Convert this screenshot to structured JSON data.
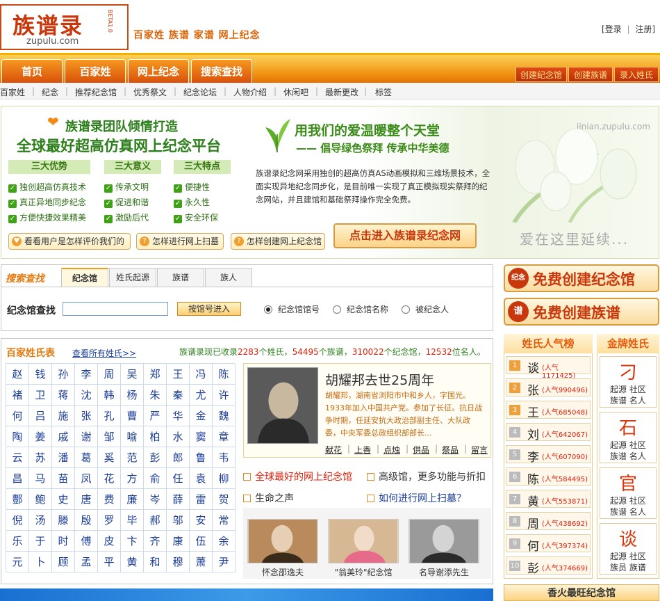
{
  "header": {
    "logo_text": "族谱录",
    "logo_domain": "zupulu.com",
    "logo_side": "BETA1.0",
    "slogan": "百家姓  族谱  家谱  网上纪念",
    "login": "[登录",
    "register": "注册]"
  },
  "nav": {
    "tabs": [
      "首页",
      "百家姓",
      "网上纪念",
      "搜索查找"
    ],
    "actions": [
      "创建纪念馆",
      "创建族谱",
      "录入姓氏"
    ],
    "sub": [
      "百家姓",
      "纪念",
      "推荐纪念馆",
      "优秀祭文",
      "纪念论坛",
      "人物介绍",
      "休闲吧",
      "最新更改",
      "标签"
    ]
  },
  "banner": {
    "title1": "族谱录团队倾情打造",
    "title2": "全球最好超高仿真网上纪念平台",
    "heads": [
      "三大优势",
      "三大意义",
      "三大特点"
    ],
    "col1": [
      "独创超高仿真技术",
      "真正异地同步纪念",
      "方便快捷效果精美"
    ],
    "col2": [
      "传承文明",
      "促进和谐",
      "激励后代"
    ],
    "col3": [
      "便捷性",
      "永久性",
      "安全环保"
    ],
    "green1": "用我们的爱温暖整个天堂",
    "green2": "—— 倡导绿色祭拜  传承中华美德",
    "url": "jinian.zupulu.com",
    "desc": "族谱录纪念网采用独创的超高仿真AS动画模拟和三维场景技术，全面实现异地纪念同步化，是目前唯一实现了真正模拟现实祭拜的纪念网站，并且建馆和基础祭拜操作完全免费。",
    "love": "爱在这里延续...",
    "btn1": "看看用户是怎样评价我们的",
    "btn2": "怎样进行网上扫墓",
    "btn3": "怎样创建网上纪念馆",
    "enter": "点击进入族谱录纪念网"
  },
  "search": {
    "title": "搜索查找",
    "tabs": [
      "纪念馆",
      "姓氏起源",
      "族谱",
      "族人"
    ],
    "label": "纪念馆查找",
    "input_value": "",
    "button": "按馆号进入",
    "radios": [
      "纪念馆馆号",
      "纪念馆名称",
      "被纪念人"
    ],
    "selected_radio": 0
  },
  "surnames": {
    "title": "百家姓氏表",
    "view_all": "查看所有姓氏>>",
    "stats_pre": "族谱录现已收录",
    "stats": [
      {
        "num": "2283",
        "unit": "个姓氏，"
      },
      {
        "num": "54495",
        "unit": "个族谱，"
      },
      {
        "num": "310022",
        "unit": "个纪念馆，"
      },
      {
        "num": "12532",
        "unit": "位名人。"
      }
    ],
    "grid": [
      [
        "赵",
        "钱",
        "孙",
        "李",
        "周",
        "吴",
        "郑",
        "王",
        "冯",
        "陈"
      ],
      [
        "褚",
        "卫",
        "蒋",
        "沈",
        "韩",
        "杨",
        "朱",
        "秦",
        "尤",
        "许"
      ],
      [
        "何",
        "吕",
        "施",
        "张",
        "孔",
        "曹",
        "严",
        "华",
        "金",
        "魏"
      ],
      [
        "陶",
        "姜",
        "戚",
        "谢",
        "邹",
        "喻",
        "柏",
        "水",
        "窦",
        "章"
      ],
      [
        "云",
        "苏",
        "潘",
        "葛",
        "奚",
        "范",
        "彭",
        "郎",
        "鲁",
        "韦"
      ],
      [
        "昌",
        "马",
        "苗",
        "凤",
        "花",
        "方",
        "俞",
        "任",
        "袁",
        "柳"
      ],
      [
        "酆",
        "鲍",
        "史",
        "唐",
        "费",
        "廉",
        "岑",
        "薛",
        "雷",
        "贺"
      ],
      [
        "倪",
        "汤",
        "滕",
        "殷",
        "罗",
        "毕",
        "郝",
        "邬",
        "安",
        "常"
      ],
      [
        "乐",
        "于",
        "时",
        "傅",
        "皮",
        "卞",
        "齐",
        "康",
        "伍",
        "余"
      ],
      [
        "元",
        "卜",
        "顾",
        "孟",
        "平",
        "黄",
        "和",
        "穆",
        "萧",
        "尹"
      ]
    ]
  },
  "feature": {
    "name": "胡耀邦去世25周年",
    "text": "胡耀邦，湖南省浏阳市中和乡人，字国光。1933年加入中国共产党。参加了长征。抗日战争时期，任延安抗大政治部副主任、大队政委，中央军委总政组织部部长...",
    "links": [
      "献花",
      "上香",
      "点烛",
      "供品",
      "祭品",
      "留言"
    ]
  },
  "promos": [
    "全球最好的网上纪念馆",
    "高级馆，更多功能与折扣",
    "生命之声",
    "如何进行网上扫墓？"
  ],
  "photos": [
    "怀念邵逸夫",
    "\"翁美玲\"纪念馆",
    "名导谢添先生"
  ],
  "right": {
    "btn1": "免费创建纪念馆",
    "btn1_icon": "纪念",
    "btn2": "免费创建族谱",
    "btn2_icon": "谱",
    "rank_title": "姓氏人气榜",
    "rank": [
      {
        "n": "1",
        "name": "谈",
        "pop": "(人气1171425)"
      },
      {
        "n": "2",
        "name": "张",
        "pop": "(人气990496)"
      },
      {
        "n": "3",
        "name": "王",
        "pop": "(人气685048)"
      },
      {
        "n": "4",
        "name": "刘",
        "pop": "(人气642067)"
      },
      {
        "n": "5",
        "name": "李",
        "pop": "(人气607090)"
      },
      {
        "n": "6",
        "name": "陈",
        "pop": "(人气584495)"
      },
      {
        "n": "7",
        "name": "黄",
        "pop": "(人气553871)"
      },
      {
        "n": "8",
        "name": "周",
        "pop": "(人气438692)"
      },
      {
        "n": "9",
        "name": "何",
        "pop": "(人气397374)"
      },
      {
        "n": "10",
        "name": "彭",
        "pop": "(人气374669)"
      }
    ],
    "gold_title": "金牌姓氏",
    "gold": [
      {
        "name": "刁",
        "l1": "起源 社区",
        "l2": "族谱 名人"
      },
      {
        "name": "石",
        "l1": "起源 社区",
        "l2": "族谱 名人"
      },
      {
        "name": "官",
        "l1": "起源 社区",
        "l2": "族谱 名人"
      },
      {
        "name": "谈",
        "l1": "起源 社区",
        "l2": "族员 族谱"
      }
    ],
    "fire": "香火最旺纪念馆"
  }
}
